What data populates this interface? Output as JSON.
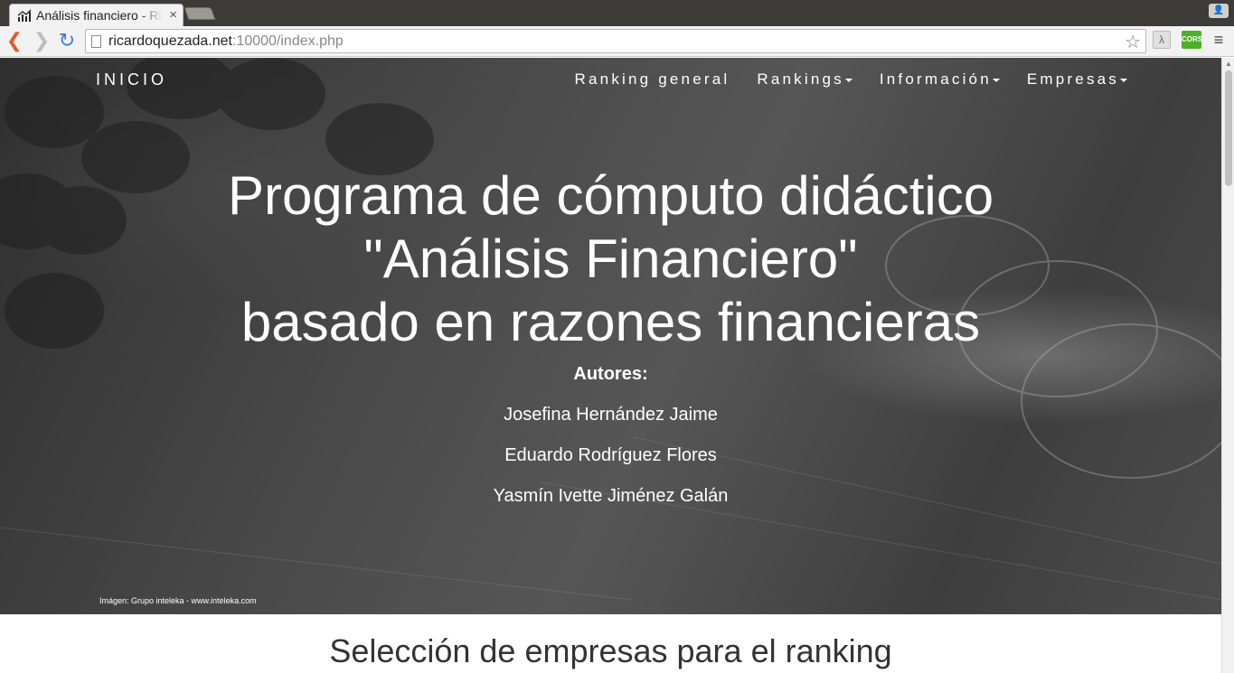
{
  "browser": {
    "tab_title": "Análisis financiero - Ricardo Quezada",
    "tab_close": "×",
    "url_host": "ricardoquezada.net",
    "url_rest": ":10000/index.php",
    "back_glyph": "❮",
    "forward_glyph": "❯",
    "reload_glyph": "↻",
    "star_glyph": "☆",
    "ext_lambda": "λ",
    "ext_cors": "CORS",
    "menu_glyph": "≡",
    "profile_glyph": "👤"
  },
  "nav": {
    "brand": "INICIO",
    "items": [
      {
        "label": "Ranking general",
        "dropdown": false
      },
      {
        "label": "Rankings",
        "dropdown": true
      },
      {
        "label": "Información",
        "dropdown": true
      },
      {
        "label": "Empresas",
        "dropdown": true
      }
    ]
  },
  "hero": {
    "title_line1": "Programa de cómputo didáctico",
    "title_line2": "\"Análisis Financiero\"",
    "title_line3": "basado en razones financieras",
    "authors_label": "Autores:",
    "authors": [
      "Josefina Hernández Jaime",
      "Eduardo Rodríguez Flores",
      "Yasmín Ivette Jiménez Galán"
    ],
    "image_credit": "Imágen: Grupo inteleka - www.inteleka.com"
  },
  "section": {
    "title": "Selección de empresas para el ranking"
  },
  "colors": {
    "chrome_dark": "#3c3b37",
    "toolbar": "#f2f2f2",
    "back_arrow": "#e05b2b",
    "reload": "#3b7ddd",
    "cors_ext": "#4caf2a",
    "hero_text": "#ffffff",
    "section_text": "#333333"
  }
}
